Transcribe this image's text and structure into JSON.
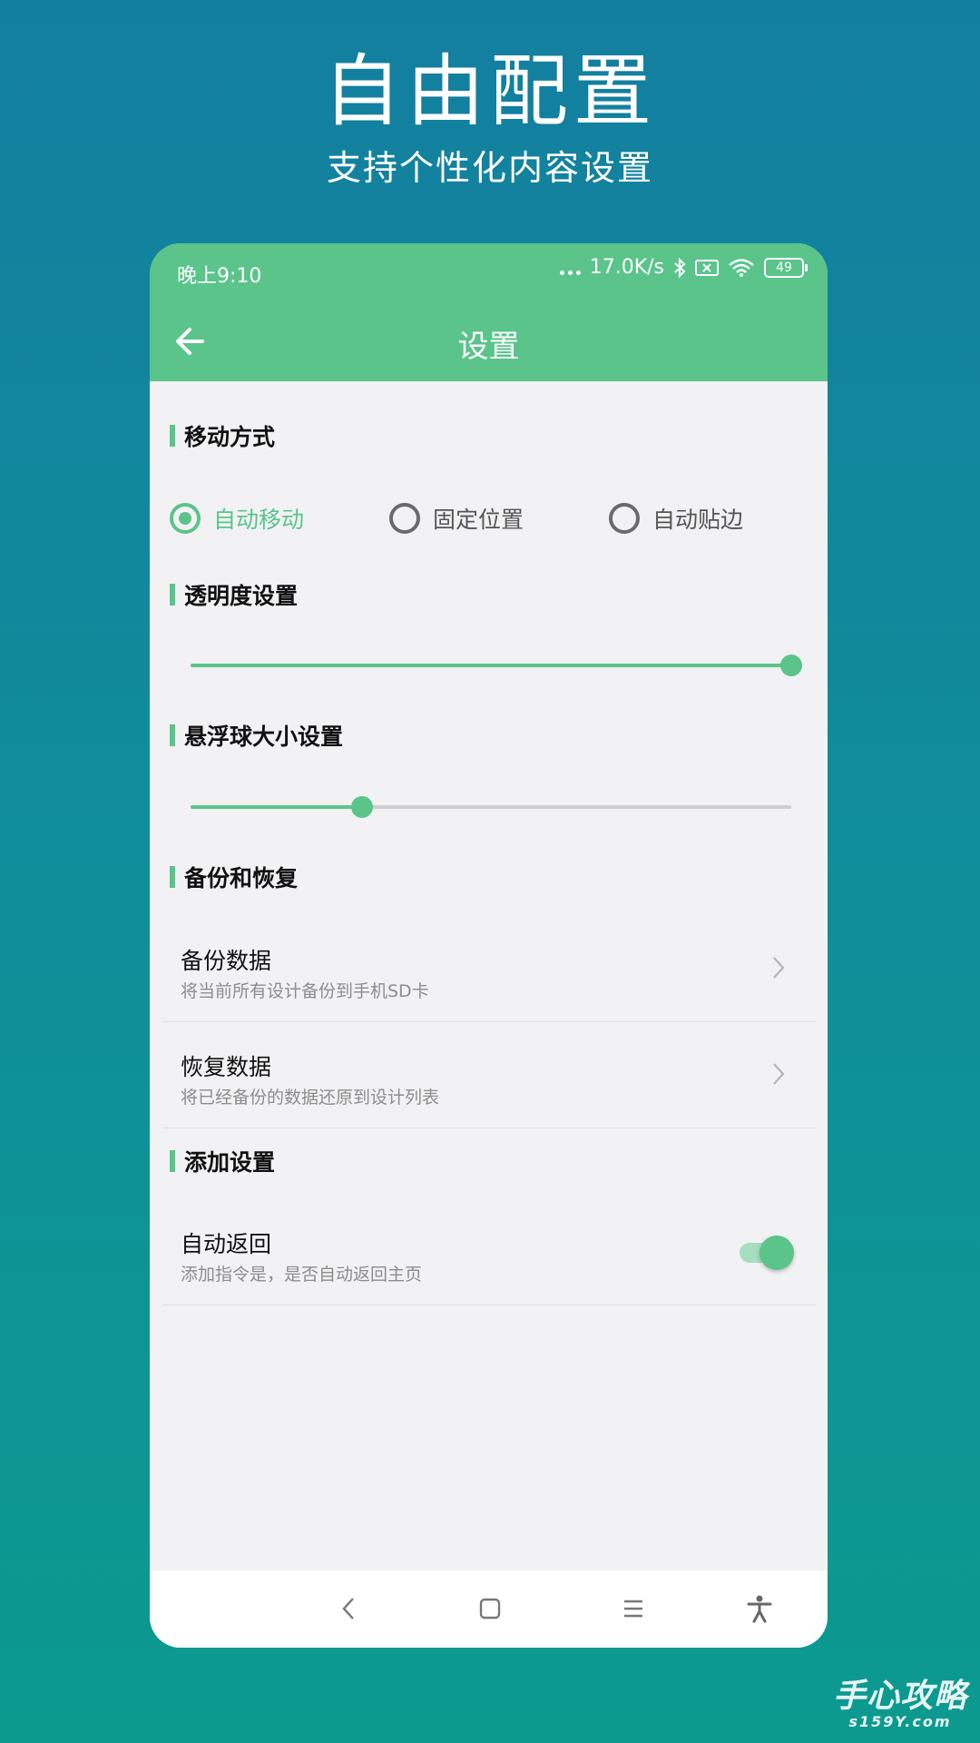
{
  "promo": {
    "title": "自由配置",
    "subtitle": "支持个性化内容设置"
  },
  "status_bar": {
    "time": "晚上9:10",
    "network_speed": "17.0K/s",
    "battery": "49"
  },
  "app_bar": {
    "title": "设置",
    "back_icon": "arrow-left-icon"
  },
  "sections": {
    "move_mode": {
      "title": "移动方式",
      "options": [
        "自动移动",
        "固定位置",
        "自动贴边"
      ],
      "selected": "自动移动"
    },
    "opacity": {
      "title": "透明度设置",
      "value_fraction": 1.0
    },
    "ball_size": {
      "title": "悬浮球大小设置",
      "value_fraction": 0.285
    },
    "backup": {
      "title": "备份和恢复",
      "items": [
        {
          "title": "备份数据",
          "desc": "将当前所有设计备份到手机SD卡"
        },
        {
          "title": "恢复数据",
          "desc": "将已经备份的数据还原到设计列表"
        }
      ]
    },
    "add_settings": {
      "title": "添加设置",
      "auto_return": {
        "title": "自动返回",
        "desc": "添加指令是，是否自动返回主页",
        "enabled": true
      }
    }
  },
  "nav_bar": {
    "icons": [
      "back-triangle-icon",
      "home-square-icon",
      "menu-lines-icon",
      "accessibility-icon"
    ]
  },
  "watermark": {
    "main": "手心攻略",
    "sub": "s159Y.com"
  },
  "colors": {
    "accent": "#5ac48b",
    "background_top": "#137fa0",
    "background_bottom": "#0c9a8f"
  }
}
